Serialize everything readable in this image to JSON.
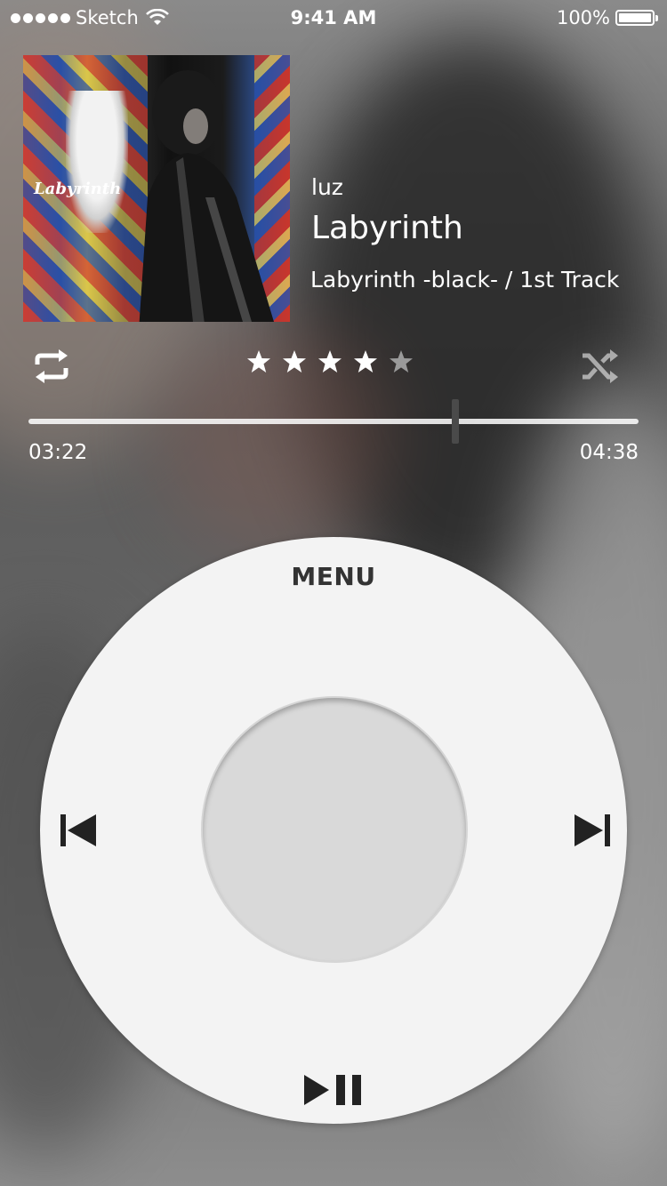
{
  "status_bar": {
    "carrier": "Sketch",
    "time": "9:41 AM",
    "battery": "100%"
  },
  "now_playing": {
    "album_art_title": "Labyrinth",
    "artist": "luz",
    "title": "Labyrinth",
    "album_line": "Labyrinth -black- / 1st Track",
    "rating": 4,
    "rating_max": 5,
    "progress_fraction": 0.7
  },
  "progress": {
    "elapsed": "03:22",
    "total": "04:38"
  },
  "wheel": {
    "menu_label": "MENU"
  },
  "icons": {
    "repeat": "repeat-icon",
    "shuffle": "shuffle-icon",
    "previous": "previous-track-icon",
    "next": "next-track-icon",
    "play_pause": "play-pause-icon"
  },
  "colors": {
    "wheel": "#f3f3f3",
    "center_button": "#d9d9d9",
    "controls_dark": "#222222",
    "star_active": "#ffffff",
    "star_inactive": "#9a9a9a"
  }
}
